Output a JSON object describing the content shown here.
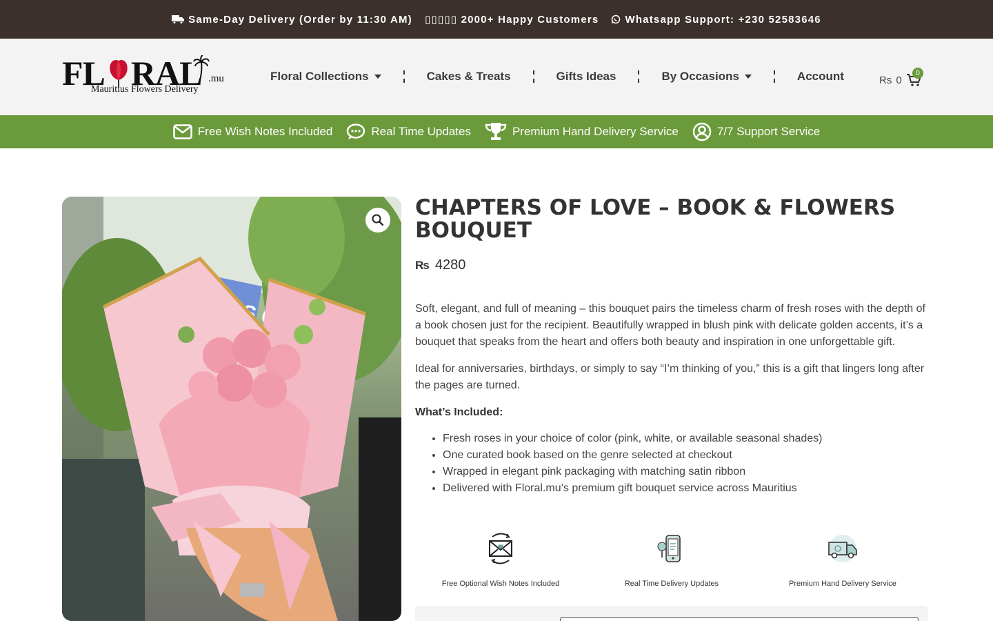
{
  "topbar": {
    "delivery": "Same-Day Delivery (Order by 11:30 AM)",
    "customers": "▯▯▯▯▯ 2000+ Happy Customers",
    "whatsapp": "Whatsapp Support: +230 52583646"
  },
  "logo": {
    "word_left": "FL",
    "word_right": "RAL",
    "domain": ".mu",
    "tagline": "Mauritius Flowers Delivery"
  },
  "nav": {
    "items": [
      {
        "label": "Floral Collections",
        "dropdown": true
      },
      {
        "label": "Cakes & Treats",
        "dropdown": false
      },
      {
        "label": "Gifts Ideas",
        "dropdown": false
      },
      {
        "label": "By Occasions",
        "dropdown": true
      },
      {
        "label": "Account",
        "dropdown": false
      }
    ]
  },
  "cart": {
    "currency": "Rs",
    "total": "0",
    "count": "0"
  },
  "strip": {
    "items": [
      {
        "icon": "envelope-icon",
        "label": "Free Wish Notes Included"
      },
      {
        "icon": "chat-icon",
        "label": "Real Time Updates"
      },
      {
        "icon": "trophy-icon",
        "label": "Premium Hand Delivery Service"
      },
      {
        "icon": "user-circle-icon",
        "label": "7/7 Support Service"
      }
    ]
  },
  "product": {
    "title": "CHAPTERS OF LOVE – BOOK & FLOWERS BOUQUET",
    "currency": "₨",
    "price": "4280",
    "desc1": "Soft, elegant, and full of meaning – this bouquet pairs the timeless charm of fresh roses with the depth of a book chosen just for the recipient. Beautifully wrapped in blush pink with delicate golden accents, it’s a bouquet that speaks from the heart and offers both beauty and inspiration in one unforgettable gift.",
    "desc2": "Ideal for anniversaries, birthdays, or simply to say “I’m thinking of you,” this is a gift that lingers long after the pages are turned.",
    "included_heading": "What’s Included:",
    "included": [
      "Fresh roses in your choice of color (pink, white, or available seasonal shades)",
      "One curated book based on the genre selected at checkout",
      "Wrapped in elegant pink packaging with matching satin ribbon",
      "Delivered with Floral.mu’s premium gift bouquet service across Mauritius"
    ],
    "image_book_text": "THIS GIRL"
  },
  "features": [
    {
      "icon": "wish-note-icon",
      "label": "Free Optional Wish Notes Included"
    },
    {
      "icon": "phone-tracking-icon",
      "label": "Real Time Delivery Updates"
    },
    {
      "icon": "delivery-truck-icon",
      "label": "Premium Hand Delivery Service"
    }
  ],
  "colors": {
    "topbar": "#3b302c",
    "strip": "#6b9a3b",
    "logo_red": "#c8102e"
  }
}
